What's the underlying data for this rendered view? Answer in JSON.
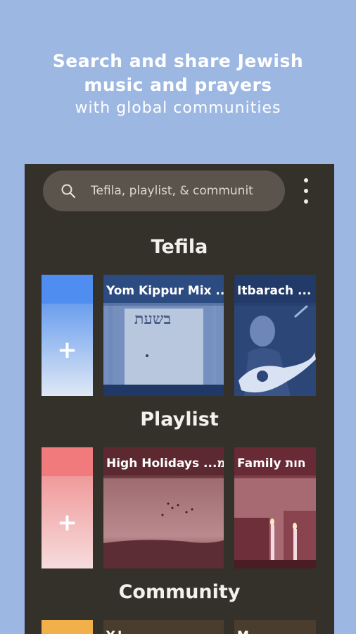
{
  "headline": {
    "line1": "Search and share Jewish",
    "line2": "music and prayers",
    "line3": "with global communities"
  },
  "search": {
    "placeholder": "Tefila, playlist, & communit"
  },
  "sections": {
    "tefila": {
      "title": "Tefila",
      "add_label": "+",
      "cards": [
        {
          "title": "Yom Kippur Mix ..."
        },
        {
          "title": "Itbarach ..."
        }
      ],
      "sign_text": "בשעת"
    },
    "playlist": {
      "title": "Playlist",
      "add_label": "+",
      "cards": [
        {
          "title": "High Holidays ...ימ"
        },
        {
          "title": "Family  חות"
        }
      ]
    },
    "community": {
      "title": "Community",
      "cards": [
        {
          "title": "Y.I. ..."
        },
        {
          "title": "M..."
        }
      ]
    }
  },
  "colors": {
    "background": "#9db7e3",
    "panel": "#34302a",
    "tefila_accent": "#4f8ef0",
    "playlist_accent": "#f07a7c",
    "community_accent": "#f2b04a"
  }
}
